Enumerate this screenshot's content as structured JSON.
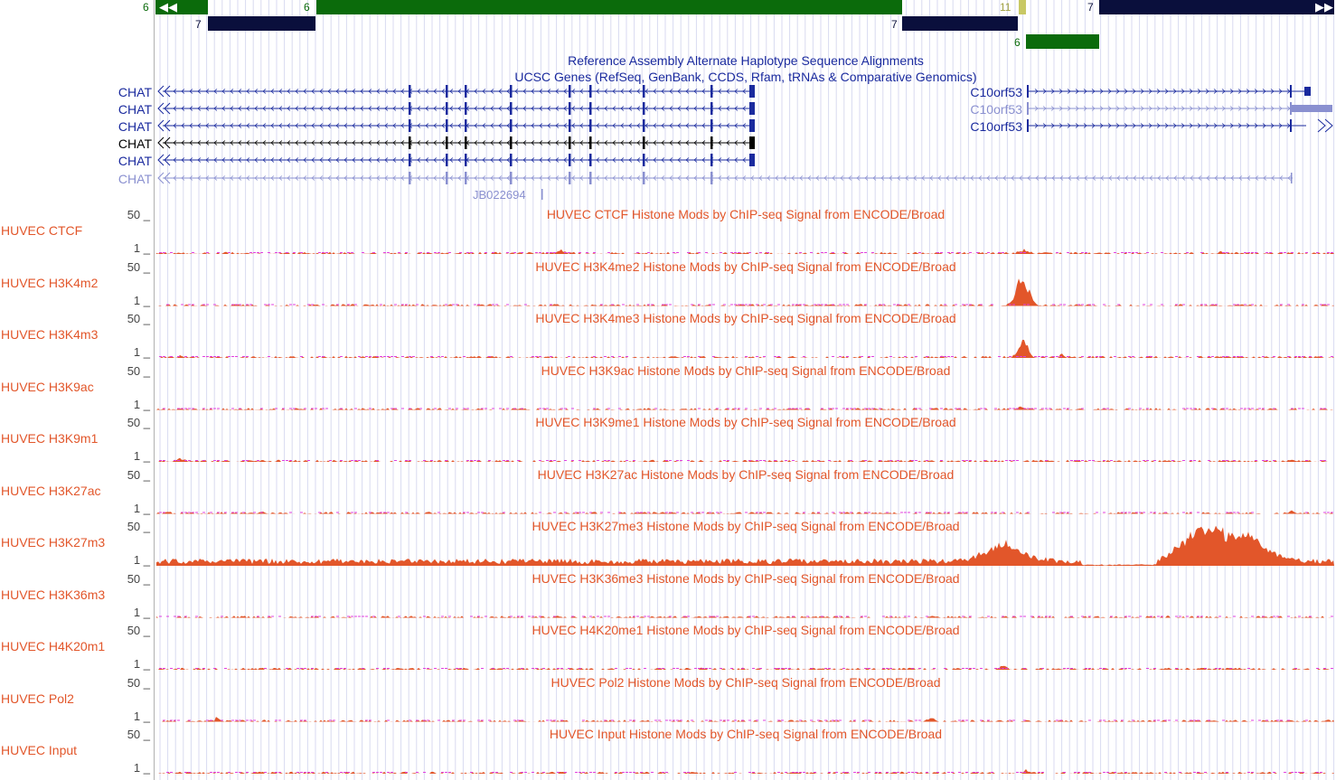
{
  "chains": {
    "row1_numbers": [
      "6",
      "6",
      "11",
      "7"
    ],
    "row2_numbers": [
      "7",
      "7"
    ],
    "row3_numbers": [
      "6"
    ],
    "colors": {
      "green": "#0b6b0b",
      "navy": "#0a0f3c",
      "olive": "#c8c864"
    }
  },
  "alignments_title": "Reference Assembly Alternate Haplotype Sequence Alignments",
  "genes_title": "UCSC Genes (RefSeq, GenBank, CCDS, Rfam, tRNAs & Comparative Genomics)",
  "genes": {
    "chat": [
      "CHAT",
      "CHAT",
      "CHAT",
      "CHAT",
      "CHAT",
      "CHAT"
    ],
    "c10orf53": [
      "C10orf53",
      "C10orf53",
      "C10orf53"
    ],
    "extra_label": "JB022694"
  },
  "signal_tracks": [
    {
      "side": "HUVEC CTCF",
      "title": "HUVEC CTCF Histone Mods by ChIP-seq Signal from ENCODE/Broad",
      "max": "50 _",
      "min": "1 _"
    },
    {
      "side": "HUVEC H3K4m2",
      "title": "HUVEC H3K4me2 Histone Mods by ChIP-seq Signal from ENCODE/Broad",
      "max": "50 _",
      "min": "1 _"
    },
    {
      "side": "HUVEC H3K4m3",
      "title": "HUVEC H3K4me3 Histone Mods by ChIP-seq Signal from ENCODE/Broad",
      "max": "50 _",
      "min": "1 _"
    },
    {
      "side": "HUVEC H3K9ac",
      "title": "HUVEC H3K9ac Histone Mods by ChIP-seq Signal from ENCODE/Broad",
      "max": "50 _",
      "min": "1 _"
    },
    {
      "side": "HUVEC H3K9m1",
      "title": "HUVEC H3K9me1 Histone Mods by ChIP-seq Signal from ENCODE/Broad",
      "max": "50 _",
      "min": "1 _"
    },
    {
      "side": "HUVEC H3K27ac",
      "title": "HUVEC H3K27ac Histone Mods by ChIP-seq Signal from ENCODE/Broad",
      "max": "50 _",
      "min": "1 _"
    },
    {
      "side": "HUVEC H3K27m3",
      "title": "HUVEC H3K27me3 Histone Mods by ChIP-seq Signal from ENCODE/Broad",
      "max": "50 _",
      "min": "1 _"
    },
    {
      "side": "HUVEC H3K36m3",
      "title": "HUVEC H3K36me3 Histone Mods by ChIP-seq Signal from ENCODE/Broad",
      "max": "50 _",
      "min": "1 _"
    },
    {
      "side": "HUVEC H4K20m1",
      "title": "HUVEC H4K20me1 Histone Mods by ChIP-seq Signal from ENCODE/Broad",
      "max": "50 _",
      "min": "1 _"
    },
    {
      "side": "HUVEC Pol2",
      "title": "HUVEC Pol2 Histone Mods by ChIP-seq Signal from ENCODE/Broad",
      "max": "50 _",
      "min": "1 _"
    },
    {
      "side": "HUVEC Input",
      "title": "HUVEC Input Histone Mods by ChIP-seq Signal from ENCODE/Broad",
      "max": "50 _",
      "min": "1 _"
    }
  ],
  "colors": {
    "signal": "#e2562a",
    "signal_dots": "#e040e0",
    "gene": "#1a2a9e",
    "gene_light": "#8a90d0",
    "grid": "#d8daf0"
  }
}
